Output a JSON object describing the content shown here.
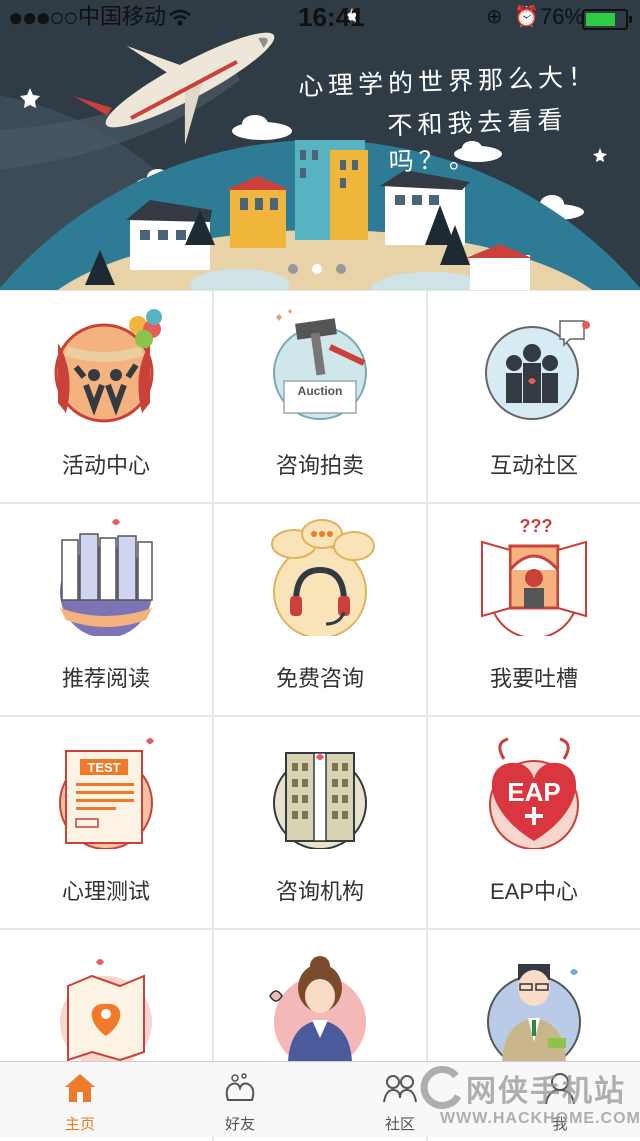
{
  "status_bar": {
    "carrier": "中国移动",
    "time": "16:41",
    "battery": "76%",
    "battery_level": 0.76
  },
  "banner": {
    "slogan_line1": "心理学的世界那么大！",
    "slogan_line2": "不和我去看看吗？。",
    "dots_total": 3,
    "active_dot": 1
  },
  "grid": {
    "items": [
      {
        "label": "活动中心",
        "icon": "activity-center-icon"
      },
      {
        "label": "咨询拍卖",
        "icon": "auction-icon",
        "icon_text": "Auction"
      },
      {
        "label": "互动社区",
        "icon": "community-icon"
      },
      {
        "label": "推荐阅读",
        "icon": "books-icon"
      },
      {
        "label": "免费咨询",
        "icon": "headset-icon"
      },
      {
        "label": "我要吐槽",
        "icon": "window-complaint-icon",
        "icon_text": "???"
      },
      {
        "label": "心理测试",
        "icon": "test-paper-icon",
        "icon_text": "TEST"
      },
      {
        "label": "咨询机构",
        "icon": "building-icon"
      },
      {
        "label": "EAP中心",
        "icon": "eap-heart-icon",
        "icon_text": "EAP"
      },
      {
        "label": "",
        "icon": "map-location-icon"
      },
      {
        "label": "",
        "icon": "female-consultant-icon"
      },
      {
        "label": "",
        "icon": "male-consultant-icon"
      }
    ]
  },
  "tabbar": {
    "tabs": [
      {
        "label": "主页",
        "icon": "home-icon",
        "active": true
      },
      {
        "label": "好友",
        "icon": "friends-icon",
        "active": false
      },
      {
        "label": "社区",
        "icon": "community-tab-icon",
        "active": false
      },
      {
        "label": "我",
        "icon": "profile-icon",
        "active": false
      }
    ]
  },
  "watermark": {
    "text_cn": "网侠手机站",
    "text_url": "WWW.HACKHOME.COM"
  },
  "colors": {
    "accent": "#f07a2a",
    "banner_sky": "#2f3b45",
    "grid_line": "#e6e6e6"
  }
}
